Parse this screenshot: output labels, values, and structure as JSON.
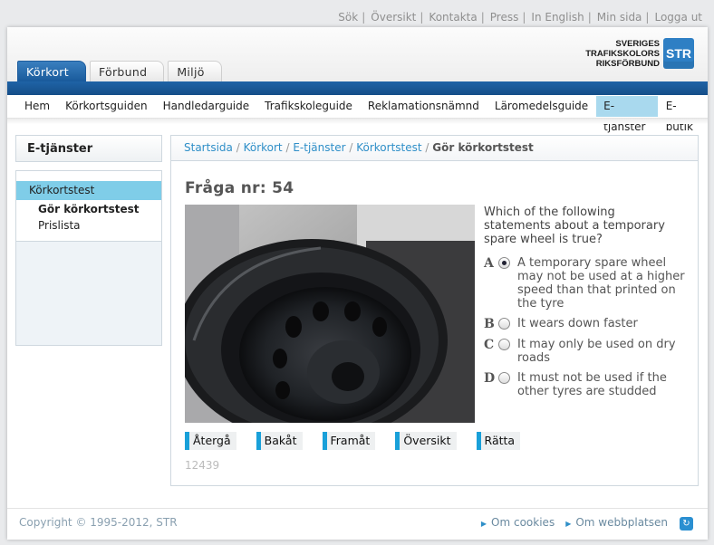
{
  "top_links": [
    "Sök",
    "Översikt",
    "Kontakta",
    "Press",
    "In English",
    "Min sida",
    "Logga ut"
  ],
  "logo": {
    "line1": "SVERIGES",
    "line2": "TRAFIKSKOLORS",
    "line3": "RIKSFÖRBUND",
    "badge": "STR"
  },
  "tabs": [
    {
      "label": "Körkort",
      "active": true
    },
    {
      "label": "Förbund"
    },
    {
      "label": "Miljö"
    }
  ],
  "main_nav": [
    {
      "label": "Hem"
    },
    {
      "label": "Körkortsguiden"
    },
    {
      "label": "Handledarguide"
    },
    {
      "label": "Trafikskoleguide"
    },
    {
      "label": "Reklamationsnämnd"
    },
    {
      "label": "Läromedelsguide"
    },
    {
      "label": "E-tjänster",
      "active": true
    },
    {
      "label": "E-butik"
    }
  ],
  "sidebar": {
    "title": "E-tjänster",
    "selected": "Körkortstest",
    "sub_items": [
      "Gör körkortstest",
      "Prislista"
    ]
  },
  "breadcrumb": {
    "links": [
      "Startsida",
      "Körkort",
      "E-tjänster",
      "Körkortstest"
    ],
    "separator": "/",
    "current": "Gör körkortstest"
  },
  "question": {
    "title": "Fråga nr: 54",
    "text": "Which of the following statements about a temporary spare wheel is true?",
    "answers": [
      {
        "letter": "A",
        "text": "A temporary spare wheel may not be used at a higher speed than that printed on the tyre",
        "selected": true
      },
      {
        "letter": "B",
        "text": "It wears down faster",
        "selected": false
      },
      {
        "letter": "C",
        "text": "It may only be used on dry roads",
        "selected": false
      },
      {
        "letter": "D",
        "text": "It must not be used if the other tyres are studded",
        "selected": false
      }
    ],
    "id": "12439"
  },
  "buttons": [
    "Återgå",
    "Bakåt",
    "Framåt",
    "Översikt",
    "Rätta"
  ],
  "footer": {
    "copyright": "Copyright © 1995-2012, STR",
    "links": [
      "Om cookies",
      "Om webbplatsen"
    ]
  },
  "colors": {
    "nav_blue": "#195a9b",
    "accent_cyan": "#19a0d9",
    "highlight": "#a9d9ee",
    "link": "#2f8fc8"
  }
}
